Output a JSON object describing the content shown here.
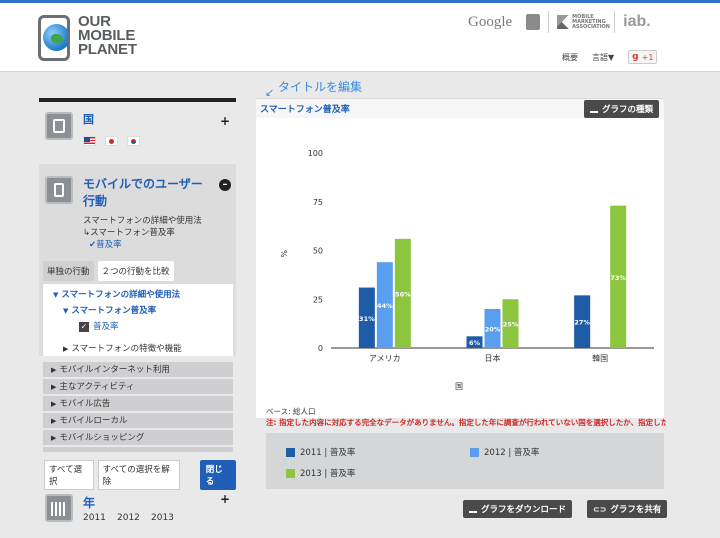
{
  "header": {
    "logo": {
      "line1": "OUR",
      "line2": "MOBILE",
      "line3": "PLANET"
    },
    "partners": {
      "google": "Google",
      "mma": "MOBILE MARKETING ASSOCIATION",
      "iab": "iab."
    },
    "links": {
      "overview": "概要",
      "language": "言語▼",
      "gplus_label": "g",
      "gplus_count": "+1"
    }
  },
  "sidebar": {
    "country": {
      "title": "国",
      "flags": [
        "US",
        "JP",
        "KR"
      ]
    },
    "mobile_behavior": {
      "title": "モバイルでのユーザー行動",
      "sub1": "スマートフォンの詳細や使用法",
      "sub2": "↳スマートフォン普及率",
      "sub3": "✔普及率",
      "tabs": [
        "単独の行動",
        "２つの行動を比較"
      ],
      "tree": {
        "item1": "スマートフォンの詳細や使用法",
        "item2": "スマートフォン普及率",
        "item3": "普及率",
        "item4": "スマートフォンの特徴や機能"
      }
    },
    "categories": [
      "モバイルインターネット利用",
      "主なアクティビティ",
      "モバイル広告",
      "モバイルローカル",
      "モバイルショッピング"
    ],
    "buttons": {
      "select_all": "すべて選択",
      "clear_all": "すべての選択を解除",
      "close": "閉じる"
    },
    "year": {
      "title": "年",
      "items": [
        "2011",
        "2012",
        "2013"
      ]
    }
  },
  "main": {
    "edit_title": "タイトルを編集",
    "chart_title": "スマートフォン普及率",
    "chart_type_button": "グラフの種類",
    "base": "ベース: 総人口",
    "note": "注: 指定した内容に対応する完全なデータがありません。指定した年に調査が行われていない国を選択したか、指定した内容で",
    "legend": [
      "2011 | 普及率",
      "2012 | 普及率",
      "2013 | 普及率"
    ],
    "download_button": "グラフをダウンロード",
    "share_button": "グラフを共有"
  },
  "colors": {
    "s2011": "#1f5ca8",
    "s2012": "#5a9ef0",
    "s2013": "#8cc63f",
    "accent": "#1f5fb8"
  },
  "chart_data": {
    "type": "bar",
    "categories": [
      "アメリカ",
      "日本",
      "韓国"
    ],
    "series": [
      {
        "name": "2011 | 普及率",
        "values": [
          31,
          6,
          27
        ]
      },
      {
        "name": "2012 | 普及率",
        "values": [
          44,
          20,
          null
        ]
      },
      {
        "name": "2013 | 普及率",
        "values": [
          56,
          25,
          73
        ]
      }
    ],
    "ylabel": "%",
    "xlabel": "国",
    "ylim": [
      0,
      100
    ],
    "yticks": [
      0,
      25,
      50,
      75,
      100
    ],
    "data_labels": true
  }
}
